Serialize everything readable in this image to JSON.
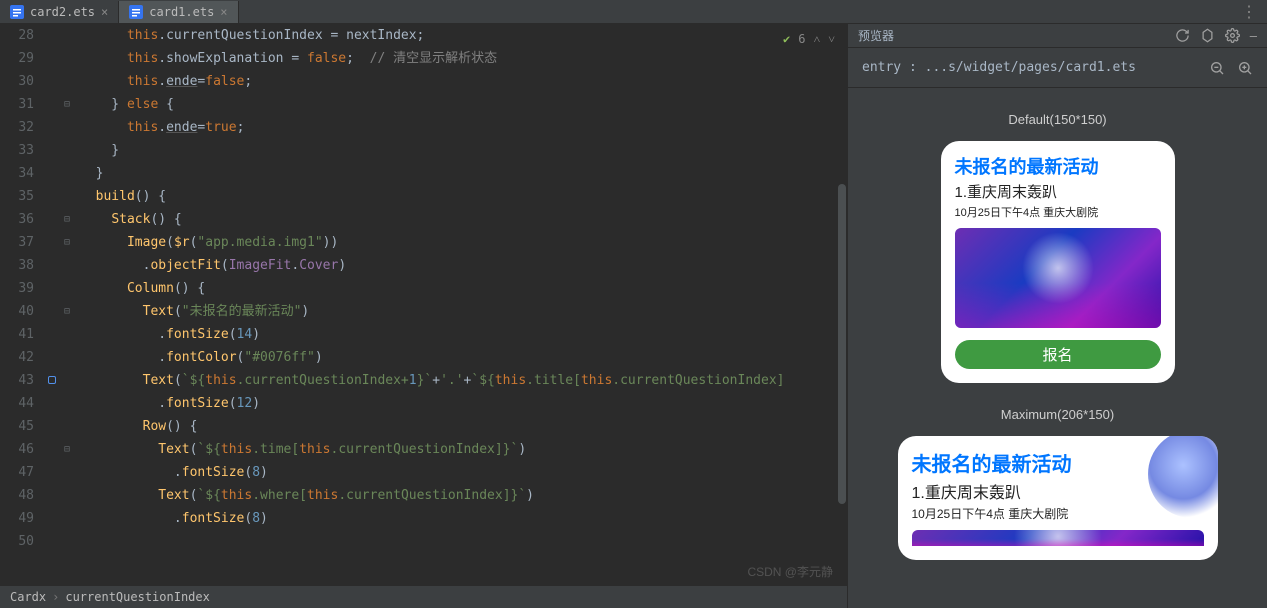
{
  "tabs": [
    {
      "label": "card2.ets",
      "active": false
    },
    {
      "label": "card1.ets",
      "active": true
    }
  ],
  "indicators": {
    "problems": "6"
  },
  "gutter_start": 28,
  "code": [
    {
      "indent": 3,
      "tokens": [
        [
          "kw",
          "this"
        ],
        [
          "",
          ".currentQuestionIndex = nextIndex;"
        ]
      ]
    },
    {
      "indent": 3,
      "tokens": [
        [
          "kw",
          "this"
        ],
        [
          "",
          ".showExplanation = "
        ],
        [
          "kw",
          "false"
        ],
        [
          "",
          ";  "
        ],
        [
          "cm",
          "// 清空显示解析状态"
        ]
      ]
    },
    {
      "indent": 3,
      "tokens": [
        [
          "kw",
          "this"
        ],
        [
          "",
          "."
        ],
        [
          "und",
          "ende"
        ],
        [
          "",
          "="
        ],
        [
          "kw",
          "false"
        ],
        [
          "",
          ";"
        ]
      ]
    },
    {
      "indent": 2,
      "tokens": [
        [
          "",
          "} "
        ],
        [
          "kw",
          "else"
        ],
        [
          "",
          " {"
        ]
      ]
    },
    {
      "indent": 3,
      "tokens": [
        [
          "kw",
          "this"
        ],
        [
          "",
          "."
        ],
        [
          "und",
          "ende"
        ],
        [
          "",
          "="
        ],
        [
          "kw",
          "true"
        ],
        [
          "",
          ";"
        ]
      ]
    },
    {
      "indent": 2,
      "tokens": [
        [
          "",
          "}"
        ]
      ]
    },
    {
      "indent": 1,
      "tokens": [
        [
          "",
          "}"
        ]
      ]
    },
    {
      "indent": 0,
      "tokens": [
        [
          "",
          ""
        ]
      ]
    },
    {
      "indent": 1,
      "tokens": [
        [
          "fn",
          "build"
        ],
        [
          "",
          "() {"
        ]
      ]
    },
    {
      "indent": 2,
      "tokens": [
        [
          "fn",
          "Stack"
        ],
        [
          "",
          "() {"
        ]
      ]
    },
    {
      "indent": 3,
      "tokens": [
        [
          "fn",
          "Image"
        ],
        [
          "",
          "("
        ],
        [
          "fn",
          "$r"
        ],
        [
          "",
          "("
        ],
        [
          "str",
          "\"app.media.img1\""
        ],
        [
          "",
          "))"
        ]
      ]
    },
    {
      "indent": 4,
      "tokens": [
        [
          "",
          "."
        ],
        [
          "fn",
          "objectFit"
        ],
        [
          "",
          "("
        ],
        [
          "prop",
          "ImageFit"
        ],
        [
          "",
          "."
        ],
        [
          "prop",
          "Cover"
        ],
        [
          "",
          ")"
        ]
      ]
    },
    {
      "indent": 3,
      "tokens": [
        [
          "fn",
          "Column"
        ],
        [
          "",
          "() {"
        ]
      ]
    },
    {
      "indent": 4,
      "tokens": [
        [
          "fn",
          "Text"
        ],
        [
          "",
          "("
        ],
        [
          "str",
          "\"未报名的最新活动\""
        ],
        [
          "",
          ")"
        ]
      ]
    },
    {
      "indent": 5,
      "tokens": [
        [
          "",
          "."
        ],
        [
          "fn",
          "fontSize"
        ],
        [
          "",
          "("
        ],
        [
          "num",
          "14"
        ],
        [
          "",
          ")"
        ]
      ]
    },
    {
      "indent": 5,
      "tokens": [
        [
          "",
          "."
        ],
        [
          "fn",
          "fontColor"
        ],
        [
          "",
          "("
        ],
        [
          "str",
          "\"#0076ff\""
        ],
        [
          "",
          ")"
        ]
      ]
    },
    {
      "indent": 4,
      "tokens": [
        [
          "fn",
          "Text"
        ],
        [
          "",
          "("
        ],
        [
          "str",
          "`${"
        ],
        [
          "kw",
          "this"
        ],
        [
          "str",
          ".currentQuestionIndex+"
        ],
        [
          "num",
          "1"
        ],
        [
          "str",
          "}`"
        ],
        [
          "",
          "+"
        ],
        [
          "str",
          "'.'"
        ],
        [
          "",
          "+"
        ],
        [
          "str",
          "`${"
        ],
        [
          "kw",
          "this"
        ],
        [
          "str",
          ".title["
        ],
        [
          "kw",
          "this"
        ],
        [
          "str",
          ".currentQuestionIndex]"
        ]
      ]
    },
    {
      "indent": 5,
      "tokens": [
        [
          "",
          "."
        ],
        [
          "fn",
          "fontSize"
        ],
        [
          "",
          "("
        ],
        [
          "num",
          "12"
        ],
        [
          "",
          ")"
        ]
      ]
    },
    {
      "indent": 4,
      "tokens": [
        [
          "fn",
          "Row"
        ],
        [
          "",
          "() {"
        ]
      ]
    },
    {
      "indent": 5,
      "tokens": [
        [
          "fn",
          "Text"
        ],
        [
          "",
          "("
        ],
        [
          "str",
          "`${"
        ],
        [
          "kw",
          "this"
        ],
        [
          "str",
          ".time["
        ],
        [
          "kw",
          "this"
        ],
        [
          "str",
          ".currentQuestionIndex]}`"
        ],
        [
          "",
          ")"
        ]
      ]
    },
    {
      "indent": 6,
      "tokens": [
        [
          "",
          "."
        ],
        [
          "fn",
          "fontSize"
        ],
        [
          "",
          "("
        ],
        [
          "num",
          "8"
        ],
        [
          "",
          ")"
        ]
      ]
    },
    {
      "indent": 5,
      "tokens": [
        [
          "fn",
          "Text"
        ],
        [
          "",
          "("
        ],
        [
          "str",
          "`${"
        ],
        [
          "kw",
          "this"
        ],
        [
          "str",
          ".where["
        ],
        [
          "kw",
          "this"
        ],
        [
          "str",
          ".currentQuestionIndex]}`"
        ],
        [
          "",
          ")"
        ]
      ]
    },
    {
      "indent": 6,
      "tokens": [
        [
          "",
          "."
        ],
        [
          "fn",
          "fontSize"
        ],
        [
          "",
          "("
        ],
        [
          "num",
          "8"
        ],
        [
          "",
          ")"
        ]
      ]
    }
  ],
  "breadcrumb": {
    "root": "Cardx",
    "leaf": "currentQuestionIndex"
  },
  "bp_line_index": 15,
  "preview": {
    "title": "预览器",
    "entry": "entry : ...s/widget/pages/card1.ets",
    "sections": [
      {
        "label": "Default(150*150)",
        "card": {
          "title": "未报名的最新活动",
          "subtitle": "1.重庆周末轰趴",
          "meta": "10月25日下午4点 重庆大剧院",
          "button": "报名",
          "size": "sz150"
        }
      },
      {
        "label": "Maximum(206*150)",
        "card": {
          "title": "未报名的最新活动",
          "subtitle": "1.重庆周末轰趴",
          "meta": "10月25日下午4点 重庆大剧院",
          "button": "",
          "size": "sz206"
        }
      }
    ]
  },
  "watermark": "CSDN @李元静",
  "colors": {
    "accent": "#0076ff",
    "button": "#3f9a41"
  }
}
